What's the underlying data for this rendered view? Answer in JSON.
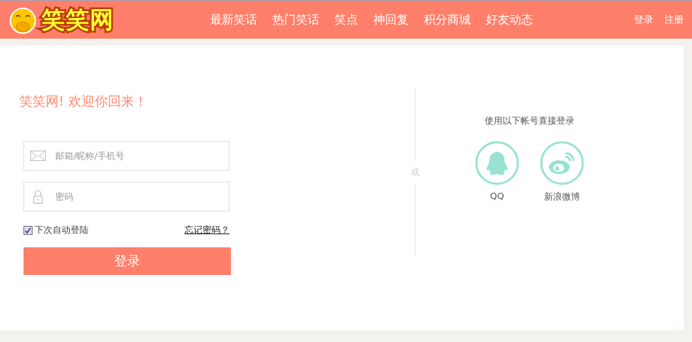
{
  "header": {
    "logo_text": "笑笑网",
    "nav": [
      "最新笑话",
      "热门笑话",
      "笑点",
      "神回复",
      "积分商城",
      "好友动态"
    ],
    "account": [
      "登录",
      "注册"
    ]
  },
  "login": {
    "welcome": "笑笑网! 欢迎你回来！",
    "username": {
      "placeholder": "邮箱/昵称/手机号"
    },
    "password": {
      "placeholder": "密码"
    },
    "remember": {
      "label": "下次自动登陆",
      "checked": true
    },
    "forgot": "忘记密码？",
    "submit": "登录"
  },
  "divider": "或",
  "social": {
    "title": "使用以下帐号直接登录",
    "providers": [
      {
        "kind": "qq",
        "label": "QQ"
      },
      {
        "kind": "weibo",
        "label": "新浪微博"
      }
    ]
  }
}
